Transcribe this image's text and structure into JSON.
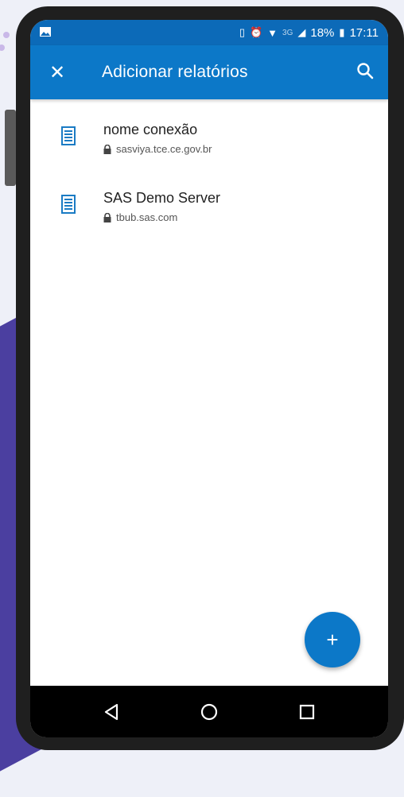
{
  "status_bar": {
    "battery": "18%",
    "time": "17:11",
    "network": "3G"
  },
  "app_bar": {
    "title": "Adicionar relatórios",
    "close_icon": "close-icon",
    "search_icon": "search-icon"
  },
  "connections": [
    {
      "name": "nome conexão",
      "host": "sasviya.tce.ce.gov.br"
    },
    {
      "name": "SAS Demo Server",
      "host": "tbub.sas.com"
    }
  ],
  "fab": {
    "icon": "plus-icon",
    "label": "+"
  },
  "colors": {
    "primary": "#0c78c8",
    "status": "#0c6ab8",
    "icon": "#1a7bc4"
  }
}
